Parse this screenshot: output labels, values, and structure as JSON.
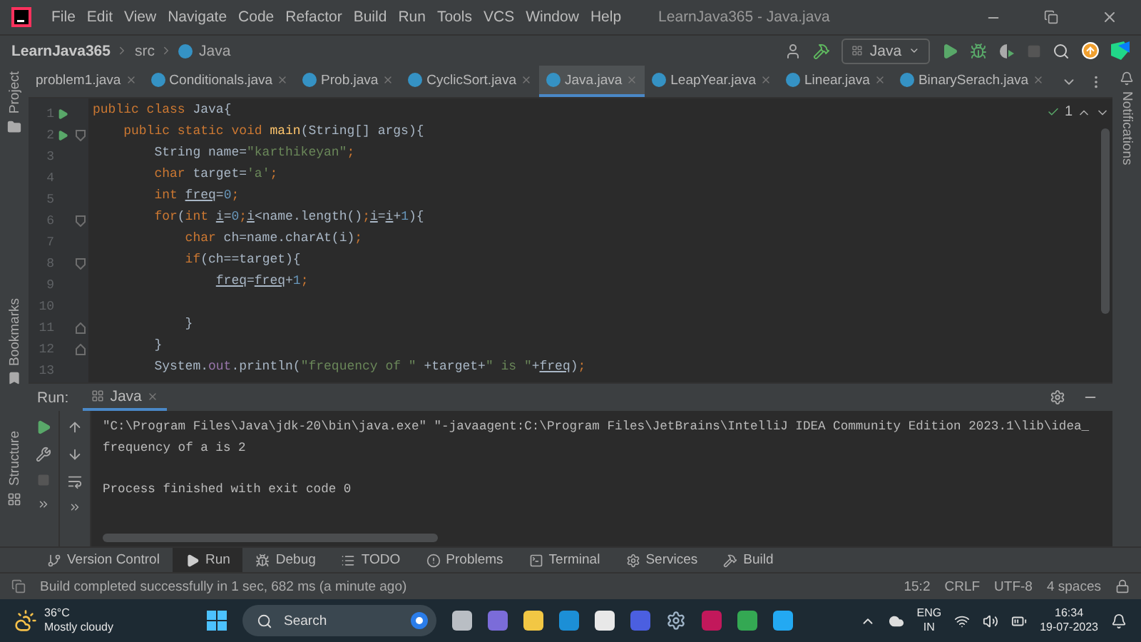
{
  "title_bar": {
    "menu": [
      "File",
      "Edit",
      "View",
      "Navigate",
      "Code",
      "Refactor",
      "Build",
      "Run",
      "Tools",
      "VCS",
      "Window",
      "Help"
    ],
    "title": "LearnJava365 - Java.java"
  },
  "nav_bar": {
    "breadcrumbs": [
      "LearnJava365",
      "src",
      "Java"
    ],
    "run_config": "Java"
  },
  "side_stripes": {
    "left": [
      "Project",
      "Bookmarks",
      "Structure"
    ],
    "right": [
      "Notifications"
    ]
  },
  "editor": {
    "tabs": [
      {
        "label": "problem1.java",
        "selected": false
      },
      {
        "label": "Conditionals.java",
        "selected": false
      },
      {
        "label": "Prob.java",
        "selected": false
      },
      {
        "label": "CyclicSort.java",
        "selected": false
      },
      {
        "label": "Java.java",
        "selected": true
      },
      {
        "label": "LeapYear.java",
        "selected": false
      },
      {
        "label": "Linear.java",
        "selected": false
      },
      {
        "label": "BinarySerach.java",
        "selected": false
      }
    ],
    "inspection_count": "1",
    "lines": [
      {
        "number": "1",
        "runnable": true,
        "fold_start": false,
        "fold_end": false,
        "tokens": [
          {
            "kind": "keyword",
            "text": "public class "
          },
          {
            "kind": "plain",
            "text": "Java{"
          }
        ]
      },
      {
        "number": "2",
        "runnable": true,
        "fold_start": true,
        "fold_end": false,
        "tokens": [
          {
            "kind": "keyword",
            "text": "public static void "
          },
          {
            "kind": "method",
            "text": "main"
          },
          {
            "kind": "plain",
            "text": "(String[] args){"
          }
        ]
      },
      {
        "number": "3",
        "runnable": false,
        "fold_start": false,
        "fold_end": false,
        "tokens": [
          {
            "kind": "plain",
            "text": "String name="
          },
          {
            "kind": "string",
            "text": "\"karthikeyan\""
          },
          {
            "kind": "keyword",
            "text": ";"
          }
        ]
      },
      {
        "number": "4",
        "runnable": false,
        "fold_start": false,
        "fold_end": false,
        "tokens": [
          {
            "kind": "keyword",
            "text": "char"
          },
          {
            "kind": "plain",
            "text": " target="
          },
          {
            "kind": "string",
            "text": "'a'"
          },
          {
            "kind": "keyword",
            "text": ";"
          }
        ]
      },
      {
        "number": "5",
        "runnable": false,
        "fold_start": false,
        "fold_end": false,
        "tokens": [
          {
            "kind": "keyword",
            "text": "int "
          },
          {
            "kind": "variable",
            "text": "freq"
          },
          {
            "kind": "plain",
            "text": "="
          },
          {
            "kind": "number",
            "text": "0"
          },
          {
            "kind": "keyword",
            "text": ";"
          }
        ]
      },
      {
        "number": "6",
        "runnable": false,
        "fold_start": true,
        "fold_end": false,
        "tokens": [
          {
            "kind": "keyword",
            "text": "for"
          },
          {
            "kind": "plain",
            "text": "("
          },
          {
            "kind": "keyword",
            "text": "int "
          },
          {
            "kind": "variable",
            "text": "i"
          },
          {
            "kind": "plain",
            "text": "="
          },
          {
            "kind": "number",
            "text": "0"
          },
          {
            "kind": "keyword",
            "text": ";"
          },
          {
            "kind": "variable",
            "text": "i"
          },
          {
            "kind": "plain",
            "text": "<name.length()"
          },
          {
            "kind": "keyword",
            "text": ";"
          },
          {
            "kind": "variable",
            "text": "i"
          },
          {
            "kind": "plain",
            "text": "="
          },
          {
            "kind": "variable",
            "text": "i"
          },
          {
            "kind": "plain",
            "text": "+"
          },
          {
            "kind": "number",
            "text": "1"
          },
          {
            "kind": "plain",
            "text": "){"
          }
        ]
      },
      {
        "number": "7",
        "runnable": false,
        "fold_start": false,
        "fold_end": false,
        "tokens": [
          {
            "kind": "keyword",
            "text": "char"
          },
          {
            "kind": "plain",
            "text": " ch=name.charAt(i)"
          },
          {
            "kind": "keyword",
            "text": ";"
          }
        ]
      },
      {
        "number": "8",
        "runnable": false,
        "fold_start": true,
        "fold_end": false,
        "tokens": [
          {
            "kind": "keyword",
            "text": "if"
          },
          {
            "kind": "plain",
            "text": "(ch==target){"
          }
        ]
      },
      {
        "number": "9",
        "runnable": false,
        "fold_start": false,
        "fold_end": false,
        "tokens": [
          {
            "kind": "variable",
            "text": "freq"
          },
          {
            "kind": "plain",
            "text": "="
          },
          {
            "kind": "variable",
            "text": "freq"
          },
          {
            "kind": "plain",
            "text": "+"
          },
          {
            "kind": "number",
            "text": "1"
          },
          {
            "kind": "keyword",
            "text": ";"
          }
        ]
      },
      {
        "number": "10",
        "runnable": false,
        "fold_start": false,
        "fold_end": false
      },
      {
        "number": "11",
        "runnable": false,
        "fold_start": false,
        "fold_end": true,
        "tokens": [
          {
            "kind": "plain",
            "text": "}"
          }
        ]
      },
      {
        "number": "12",
        "runnable": false,
        "fold_start": false,
        "fold_end": true,
        "tokens": [
          {
            "kind": "plain",
            "text": "}"
          }
        ]
      },
      {
        "number": "13",
        "runnable": false,
        "fold_start": false,
        "fold_end": false,
        "tokens": [
          {
            "kind": "plain",
            "text": "System."
          },
          {
            "kind": "field",
            "text": "out"
          },
          {
            "kind": "plain",
            "text": ".println("
          },
          {
            "kind": "string",
            "text": "\"frequency of \""
          },
          {
            "kind": "plain",
            "text": " +target+"
          },
          {
            "kind": "string",
            "text": "\" is \""
          },
          {
            "kind": "plain",
            "text": "+"
          },
          {
            "kind": "variable",
            "text": "freq"
          },
          {
            "kind": "plain",
            "text": ")"
          },
          {
            "kind": "keyword",
            "text": ";"
          }
        ]
      }
    ]
  },
  "run_panel": {
    "label": "Run:",
    "tab": "Java",
    "output": [
      {
        "kind": "command",
        "text": "\"C:\\Program Files\\Java\\jdk-20\\bin\\java.exe\" \"-javaagent:C:\\Program Files\\JetBrains\\IntelliJ IDEA Community Edition 2023.1\\lib\\idea_"
      },
      {
        "kind": "stdout",
        "text": "frequency of a is 2"
      },
      {
        "kind": "exit",
        "text": "Process finished with exit code 0"
      }
    ]
  },
  "tool_windows": [
    {
      "kind": "vcs",
      "label": "Version Control",
      "selected": false
    },
    {
      "kind": "run",
      "label": "Run",
      "selected": true
    },
    {
      "kind": "debug",
      "label": "Debug",
      "selected": false
    },
    {
      "kind": "todo",
      "label": "TODO",
      "selected": false
    },
    {
      "kind": "problems",
      "label": "Problems",
      "selected": false
    },
    {
      "kind": "terminal",
      "label": "Terminal",
      "selected": false
    },
    {
      "kind": "services",
      "label": "Services",
      "selected": false
    },
    {
      "kind": "build",
      "label": "Build",
      "selected": false
    }
  ],
  "status_bar": {
    "message": "Build completed successfully in 1 sec, 682 ms (a minute ago)",
    "items": [
      "15:2",
      "CRLF",
      "UTF-8",
      "4 spaces"
    ]
  },
  "taskbar": {
    "weather": {
      "temperature": "36°C",
      "condition": "Mostly cloudy"
    },
    "search": {
      "placeholder": "Search"
    },
    "language": [
      "ENG",
      "IN"
    ],
    "time": "16:34",
    "date": "19-07-2023"
  }
}
